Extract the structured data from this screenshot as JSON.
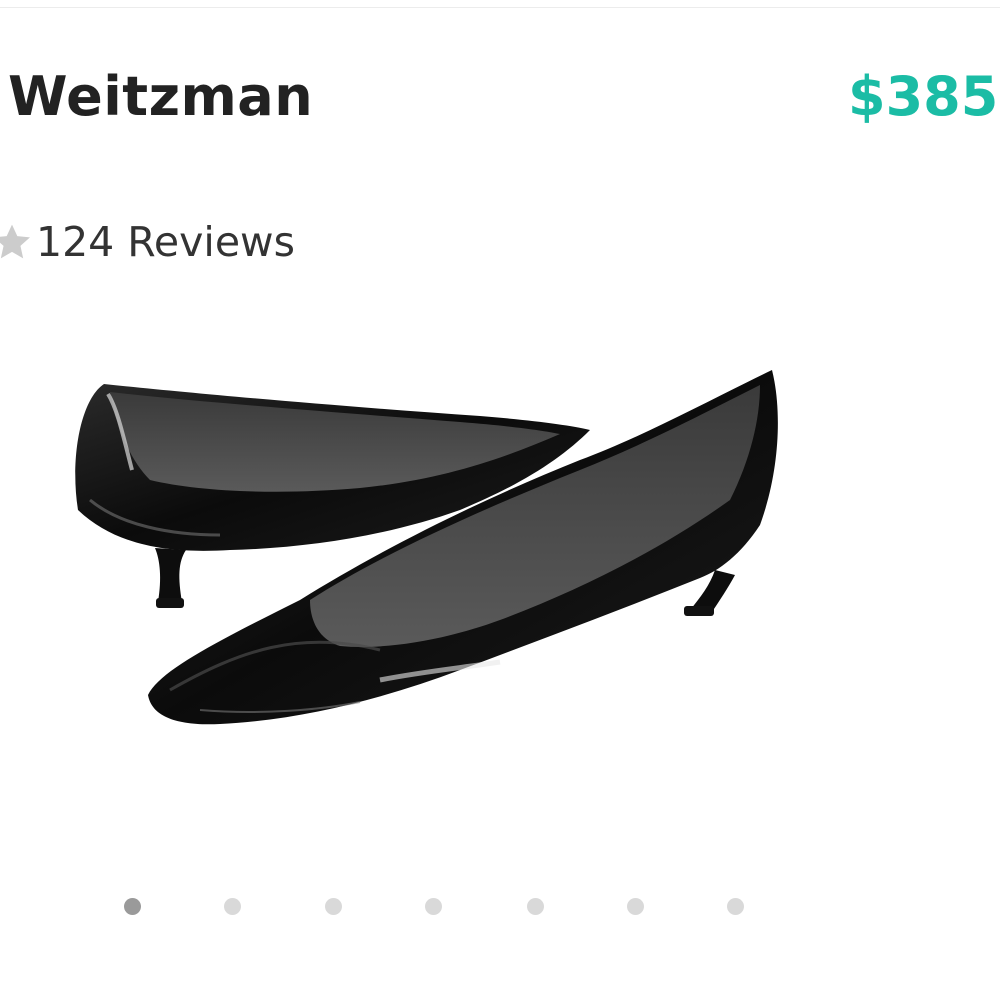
{
  "product": {
    "brand": "Weitzman",
    "price": "$385.00",
    "reviews_label": "124 Reviews",
    "rating_stars": 0
  },
  "colors": {
    "price": "#1bbca5",
    "star_empty": "#cccccc",
    "dot_active": "#9a9a9a",
    "dot_inactive": "#d9d9d9"
  },
  "image": {
    "subject": "black patent leather pointed-toe kitten heel pumps (pair)"
  },
  "carousel": {
    "count": 7,
    "active_index": 0
  }
}
